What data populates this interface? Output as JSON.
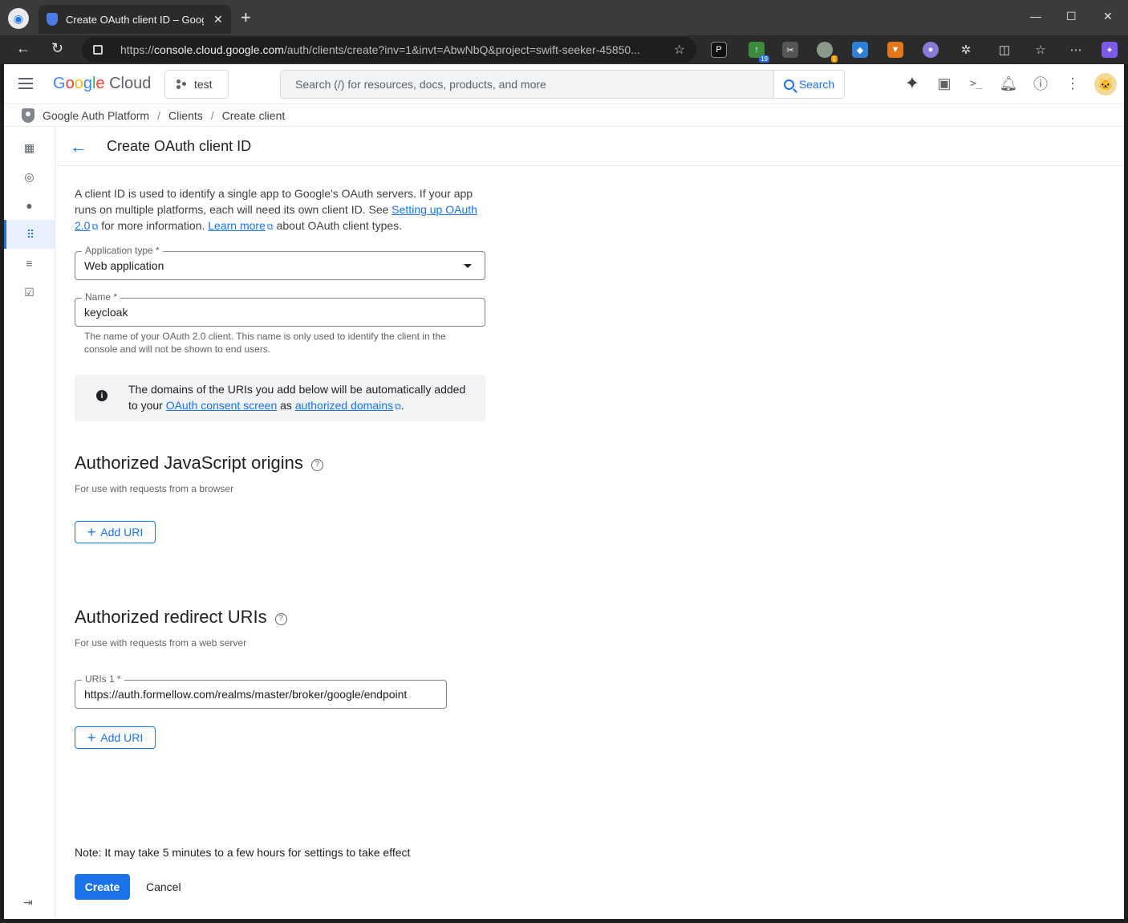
{
  "browser": {
    "tab_title": "Create OAuth client ID – Google Auth Platform",
    "tab_close": "✕",
    "new_tab": "+",
    "url_prefix": "https://",
    "url_host": "console.cloud.google.com",
    "url_path": "/auth/clients/create?inv=1&invt=AbwNbQ&project=swift-seeker-45850...",
    "extension_badges": [
      "19",
      "1"
    ],
    "window_controls": [
      "—",
      "☐",
      "✕"
    ]
  },
  "header": {
    "logo_letters": [
      "G",
      "o",
      "o",
      "g",
      "l",
      "e"
    ],
    "logo_product": "Cloud",
    "project": "test",
    "search_placeholder": "Search (/) for resources, docs, products, and more",
    "search_button": "Search"
  },
  "breadcrumb": {
    "items": [
      "Google Auth Platform",
      "Clients",
      "Create client"
    ],
    "separator": "/"
  },
  "page": {
    "back": "←",
    "title": "Create OAuth client ID"
  },
  "intro": {
    "text_1": "A client ID is used to identify a single app to Google's OAuth servers. If your app runs on multiple platforms, each will need its own client ID. See ",
    "link_1": "Setting up OAuth 2.0",
    "text_2": " for more information. ",
    "link_2": "Learn more",
    "text_3": " about OAuth client types."
  },
  "form": {
    "application_type_label": "Application type *",
    "application_type_value": "Web application",
    "name_label": "Name *",
    "name_value": "keycloak",
    "name_hint": "The name of your OAuth 2.0 client. This name is only used to identify the client in the console and will not be shown to end users."
  },
  "notice": {
    "text_1": "The domains of the URIs you add below will be automatically added to your ",
    "link_1": "OAuth consent screen",
    "text_2": " as ",
    "link_2": "authorized domains",
    "text_3": "."
  },
  "js_origins": {
    "title": "Authorized JavaScript origins",
    "subtitle": "For use with requests from a browser",
    "add_button": "Add URI"
  },
  "redirect_uris": {
    "title": "Authorized redirect URIs",
    "subtitle": "For use with requests from a web server",
    "uri_label": "URIs 1 *",
    "uri_value": "https://auth.formellow.com/realms/master/broker/google/endpoint",
    "add_button": "Add URI"
  },
  "footer": {
    "note": "Note: It may take 5 minutes to a few hours for settings to take effect",
    "create": "Create",
    "cancel": "Cancel"
  },
  "colors": {
    "primary": "#1a73e8",
    "text": "#202124",
    "muted": "#5f6368",
    "notice_bg": "#f1f3f4"
  },
  "icons": [
    "menu-icon",
    "search-icon",
    "gemini-icon",
    "gift-icon",
    "terminal-icon",
    "bell-icon",
    "help-icon",
    "more-icon",
    "info-icon",
    "back-arrow-icon",
    "dropdown-icon",
    "external-link-icon",
    "plus-icon"
  ]
}
